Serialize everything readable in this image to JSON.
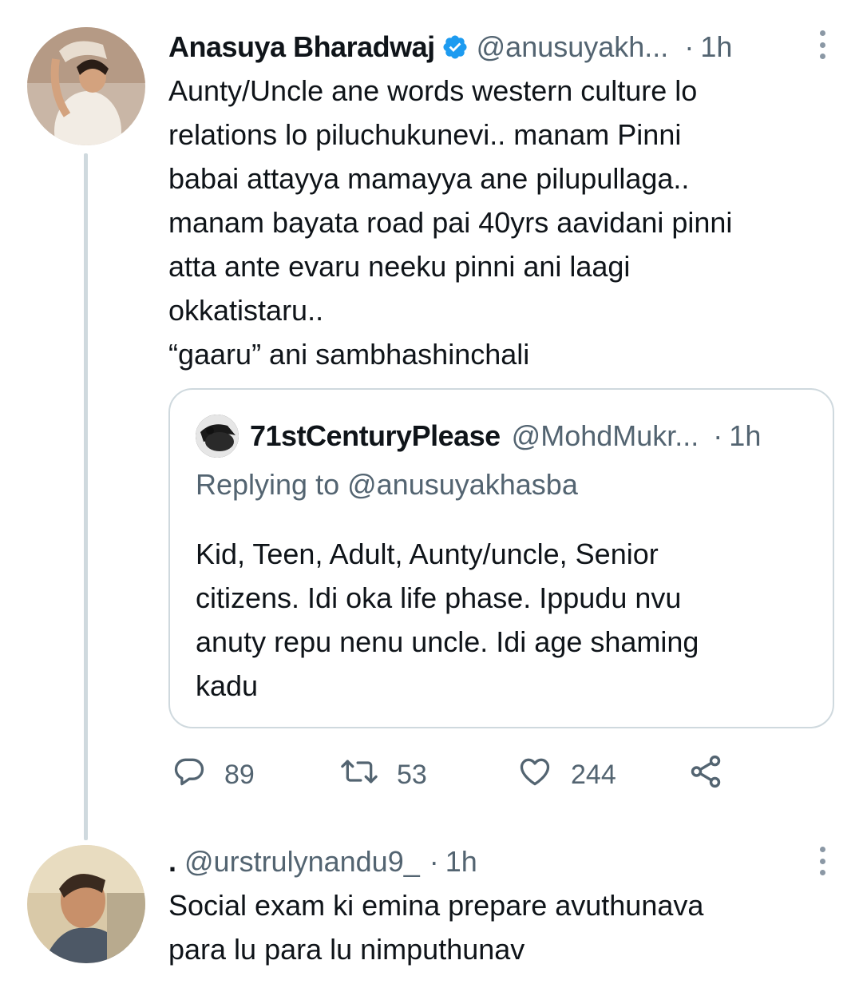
{
  "main_tweet": {
    "author_name": "Anasuya Bharadwaj",
    "handle": "@anusuyakh...",
    "separator": "·",
    "time": "1h",
    "verified": true,
    "text_lines": [
      "Aunty/Uncle ane words western culture lo",
      "relations lo piluchukunevi.. manam Pinni",
      "babai attayya mamayya ane pilupullaga..",
      "manam bayata road pai 40yrs aavidani pinni",
      "atta ante evaru neeku pinni ani laagi",
      "okkatistaru..",
      "“gaaru” ani sambhashinchali"
    ]
  },
  "quoted_tweet": {
    "author_name": "71stCenturyPlease",
    "handle": "@MohdMukr...",
    "separator": "·",
    "time": "1h",
    "replying_to": "Replying to @anusuyakhasba",
    "text_lines": [
      "Kid, Teen, Adult, Aunty/uncle, Senior",
      "citizens. Idi oka life phase. Ippudu nvu",
      "anuty repu nenu uncle. Idi age shaming",
      "kadu"
    ]
  },
  "actions": {
    "reply_count": "89",
    "retweet_count": "53",
    "like_count": "244"
  },
  "reply_tweet": {
    "author_name": ".",
    "handle": "@urstrulynandu9_",
    "separator": "·",
    "time": "1h",
    "text_lines": [
      "Social exam ki emina prepare avuthunava",
      "para lu para lu nimputhunav"
    ]
  },
  "colors": {
    "text_primary": "#0f1419",
    "text_secondary": "#536471",
    "border": "#cfd9de",
    "verified_blue": "#1d9bf0"
  },
  "icons": [
    "more-icon",
    "verified-icon",
    "reply-icon",
    "retweet-icon",
    "like-icon",
    "share-icon"
  ]
}
